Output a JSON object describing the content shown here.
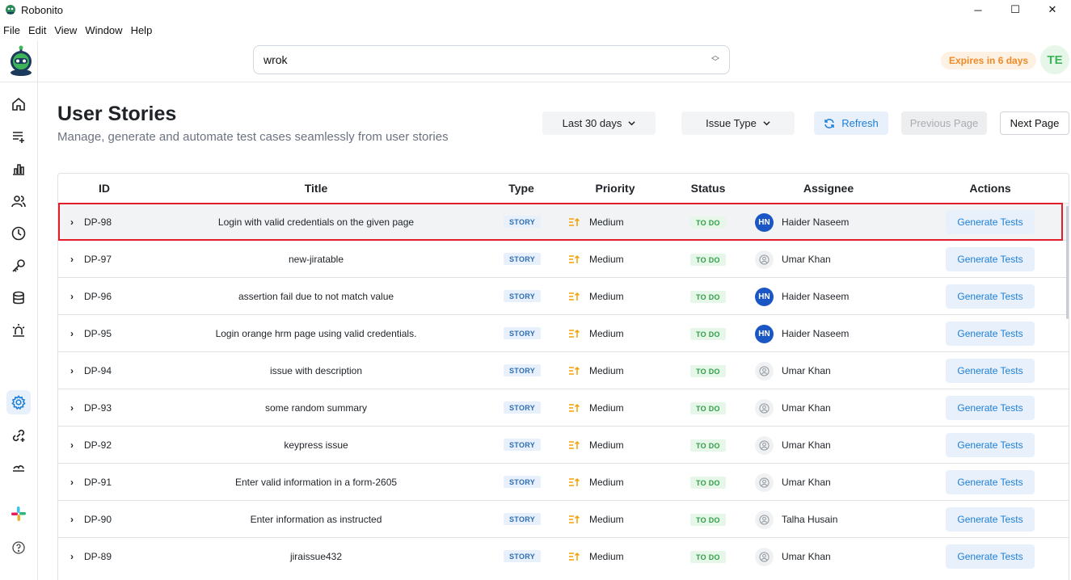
{
  "window": {
    "title": "Robonito",
    "min_glyph": "─",
    "max_glyph": "☐",
    "close_glyph": "✕"
  },
  "menu": [
    "File",
    "Edit",
    "View",
    "Window",
    "Help"
  ],
  "header": {
    "project_value": "wrok",
    "expiry_badge": "Expires in 6 days",
    "user_initials": "TE"
  },
  "page": {
    "title": "User Stories",
    "subtitle": "Manage, generate and automate test cases seamlessly from user stories"
  },
  "toolbar": {
    "date_filter": "Last 30 days",
    "type_filter": "Issue Type",
    "refresh_label": "Refresh",
    "prev_label": "Previous Page",
    "next_label": "Next Page"
  },
  "table": {
    "columns": [
      "ID",
      "Title",
      "Type",
      "Priority",
      "Status",
      "Assignee",
      "Actions"
    ],
    "rows": [
      {
        "id": "DP-98",
        "title": "Login with valid credentials on the given page",
        "type": "STORY",
        "priority": "Medium",
        "status": "TO DO",
        "assignee_initials": "HN",
        "assignee": "Haider Naseem",
        "action": "Generate Tests"
      },
      {
        "id": "DP-97",
        "title": "new-jiratable",
        "type": "STORY",
        "priority": "Medium",
        "status": "TO DO",
        "assignee_initials": "",
        "assignee": "Umar Khan",
        "action": "Generate Tests"
      },
      {
        "id": "DP-96",
        "title": "assertion fail due to not match value",
        "type": "STORY",
        "priority": "Medium",
        "status": "TO DO",
        "assignee_initials": "HN",
        "assignee": "Haider Naseem",
        "action": "Generate Tests"
      },
      {
        "id": "DP-95",
        "title": "Login orange hrm page using valid credentials.",
        "type": "STORY",
        "priority": "Medium",
        "status": "TO DO",
        "assignee_initials": "HN",
        "assignee": "Haider Naseem",
        "action": "Generate Tests"
      },
      {
        "id": "DP-94",
        "title": "issue with description",
        "type": "STORY",
        "priority": "Medium",
        "status": "TO DO",
        "assignee_initials": "",
        "assignee": "Umar Khan",
        "action": "Generate Tests"
      },
      {
        "id": "DP-93",
        "title": "some random summary",
        "type": "STORY",
        "priority": "Medium",
        "status": "TO DO",
        "assignee_initials": "",
        "assignee": "Umar Khan",
        "action": "Generate Tests"
      },
      {
        "id": "DP-92",
        "title": "keypress issue",
        "type": "STORY",
        "priority": "Medium",
        "status": "TO DO",
        "assignee_initials": "",
        "assignee": "Umar Khan",
        "action": "Generate Tests"
      },
      {
        "id": "DP-91",
        "title": "Enter valid information in a form-2605",
        "type": "STORY",
        "priority": "Medium",
        "status": "TO DO",
        "assignee_initials": "",
        "assignee": "Umar Khan",
        "action": "Generate Tests"
      },
      {
        "id": "DP-90",
        "title": "Enter information as instructed",
        "type": "STORY",
        "priority": "Medium",
        "status": "TO DO",
        "assignee_initials": "",
        "assignee": "Talha Husain",
        "action": "Generate Tests"
      },
      {
        "id": "DP-89",
        "title": "jiraissue432",
        "type": "STORY",
        "priority": "Medium",
        "status": "TO DO",
        "assignee_initials": "",
        "assignee": "Umar Khan",
        "action": "Generate Tests"
      }
    ]
  },
  "colors": {
    "accent": "#1c7ed6",
    "selection_outline": "#e11d2a",
    "priority_icon": "#f59f00",
    "status_green": "#2f9e44"
  }
}
